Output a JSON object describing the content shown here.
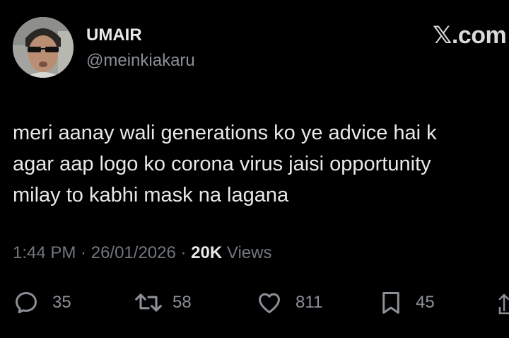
{
  "user": {
    "name": "UMAIR",
    "handle": "@meinkiakaru"
  },
  "brand": {
    "x_glyph": "𝕏",
    "suffix": ".com"
  },
  "tweet": {
    "text_lines": [
      "meri aanay wali generations ko ye advice hai k",
      "agar aap logo ko corona virus jaisi opportunity",
      "milay to kabhi mask na lagana"
    ]
  },
  "meta": {
    "time": "1:44 PM",
    "sep1": " · ",
    "date": "26/01/2026",
    "sep2": " · ",
    "views_count": "20K",
    "views_label": " Views"
  },
  "actions": {
    "replies": "35",
    "reposts": "58",
    "likes": "811",
    "bookmarks": "45"
  },
  "icons": [
    "reply-icon",
    "repost-icon",
    "like-icon",
    "bookmark-icon",
    "share-icon"
  ],
  "colors": {
    "background": "#000000",
    "text": "#e7e9ea",
    "muted": "#71767b"
  }
}
